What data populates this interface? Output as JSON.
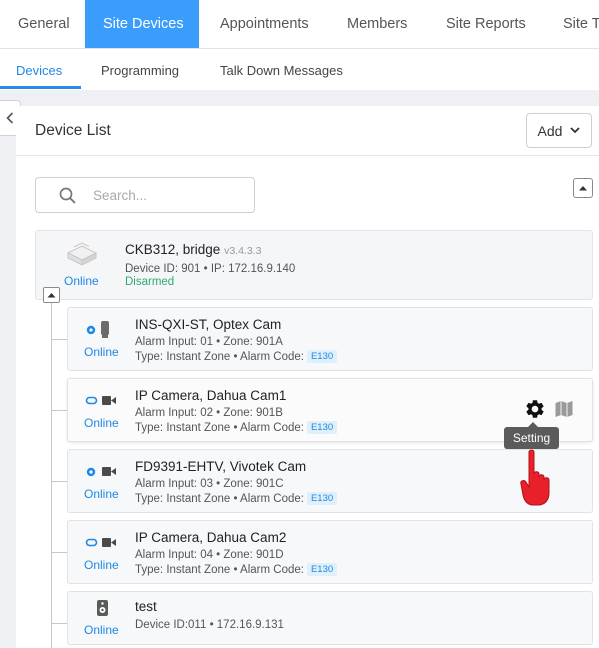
{
  "top_tabs": [
    {
      "label": "General",
      "active": false
    },
    {
      "label": "Site Devices",
      "active": true
    },
    {
      "label": "Appointments",
      "active": false
    },
    {
      "label": "Members",
      "active": false
    },
    {
      "label": "Site Reports",
      "active": false
    },
    {
      "label": "Site To",
      "active": false
    }
  ],
  "sub_tabs": [
    {
      "label": "Devices",
      "active": true
    },
    {
      "label": "Programming",
      "active": false
    },
    {
      "label": "Talk Down Messages",
      "active": false
    }
  ],
  "panel": {
    "title": "Device List",
    "add_label": "Add"
  },
  "search": {
    "placeholder": "Search..."
  },
  "bridge": {
    "name": "CKB312, bridge",
    "version": "v3.4.3.3",
    "info": "Device ID: 901 • IP: 172.16.9.140",
    "status": "Online",
    "armed": "Disarmed"
  },
  "devices": [
    {
      "name": "INS-QXI-ST, Optex Cam",
      "line1": "Alarm Input: 01 • Zone: 901A",
      "line2": "Type: Instant Zone • Alarm Code:",
      "badge": "E130",
      "status": "Online",
      "icon": "smart-camera-icon"
    },
    {
      "name": "IP Camera, Dahua Cam1",
      "line1": "Alarm Input: 02 • Zone: 901B",
      "line2": "Type: Instant Zone • Alarm Code:",
      "badge": "E130",
      "status": "Online",
      "icon": "ip-camera-icon"
    },
    {
      "name": "FD9391-EHTV, Vivotek Cam",
      "line1": "Alarm Input: 03 • Zone: 901C",
      "line2": "Type: Instant Zone • Alarm Code:",
      "badge": "E130",
      "status": "Online",
      "icon": "smart-camera-icon"
    },
    {
      "name": "IP Camera, Dahua Cam2",
      "line1": "Alarm Input: 04 • Zone: 901D",
      "line2": "Type: Instant Zone • Alarm Code:",
      "badge": "E130",
      "status": "Online",
      "icon": "ip-camera-icon"
    },
    {
      "name": "test",
      "line1": "Device ID:011 • 172.16.9.131",
      "status": "Online",
      "icon": "speaker-icon"
    }
  ],
  "tooltip": {
    "text": "Setting"
  },
  "colors": {
    "accent": "#3b9dfb",
    "online": "#1e88e5",
    "disarmed": "#2eaa6e",
    "badge_bg": "#dff0fb"
  }
}
